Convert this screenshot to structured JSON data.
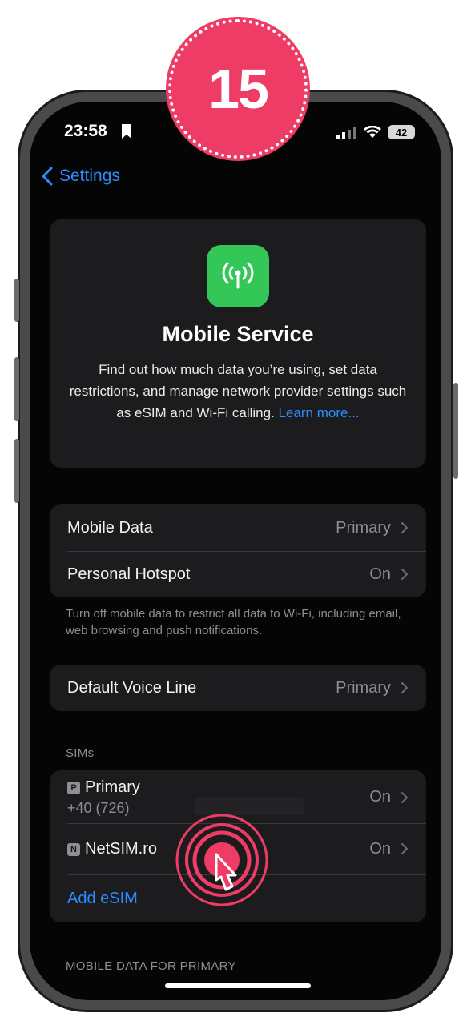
{
  "badge": {
    "step_number": "15"
  },
  "status_bar": {
    "time": "23:58",
    "battery_level": "42"
  },
  "nav": {
    "back_label": "Settings"
  },
  "hero": {
    "title": "Mobile Service",
    "description": "Find out how much data you’re using, set data restrictions, and manage network provider settings such as eSIM and Wi-Fi calling.",
    "learn_more": "Learn more..."
  },
  "data_group": {
    "rows": [
      {
        "label": "Mobile Data",
        "value": "Primary"
      },
      {
        "label": "Personal Hotspot",
        "value": "On"
      }
    ],
    "footnote": "Turn off mobile data to restrict all data to Wi-Fi, including email, web browsing and push notifications."
  },
  "voice_group": {
    "label": "Default Voice Line",
    "value": "Primary"
  },
  "sims": {
    "header": "SIMs",
    "items": [
      {
        "icon_letter": "P",
        "label": "Primary",
        "number": "+40 (726)",
        "value": "On"
      },
      {
        "icon_letter": "N",
        "label": "NetSIM.ro",
        "value": "On"
      }
    ],
    "add_label": "Add eSIM"
  },
  "bottom_header": "MOBILE DATA FOR PRIMARY",
  "colors": {
    "accent": "#2d8cff",
    "badge": "#ee3c66",
    "app_icon": "#33c758",
    "card": "#1c1c1e"
  },
  "icons": [
    "bookmark-icon",
    "signal-icon",
    "wifi-icon",
    "battery-icon",
    "back-chevron-icon",
    "antenna-icon",
    "chevron-right-icon",
    "sim-card-icon",
    "tap-gesture-icon"
  ]
}
